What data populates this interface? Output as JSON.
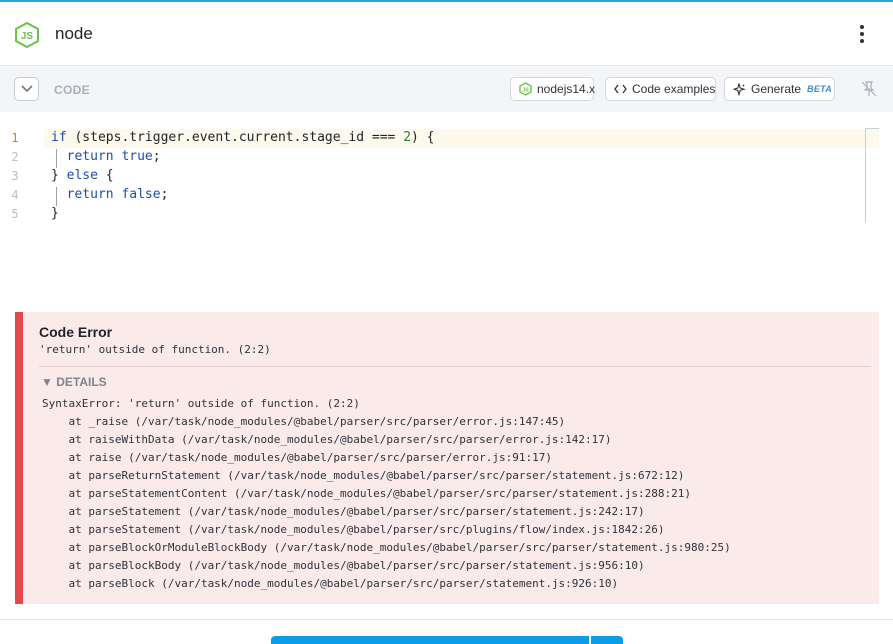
{
  "header": {
    "title": "node",
    "logo_icon": "nodejs-logo-icon",
    "menu_icon": "kebab-menu-icon"
  },
  "toolbar": {
    "code_label": "CODE",
    "runtime_label": "nodejs14.x",
    "examples_label": "Code examples",
    "generate_label": "Generate",
    "beta_label": "BETA"
  },
  "editor": {
    "line_numbers": [
      "1",
      "2",
      "3",
      "4",
      "5"
    ],
    "active_line": 1
  },
  "error": {
    "title": "Code Error",
    "message": "'return' outside of function. (2:2)",
    "details_label": "▼ DETAILS",
    "trace": [
      "SyntaxError: 'return' outside of function. (2:2)",
      "    at _raise (/var/task/node_modules/@babel/parser/src/parser/error.js:147:45)",
      "    at raiseWithData (/var/task/node_modules/@babel/parser/src/parser/error.js:142:17)",
      "    at raise (/var/task/node_modules/@babel/parser/src/parser/error.js:91:17)",
      "    at parseReturnStatement (/var/task/node_modules/@babel/parser/src/parser/statement.js:672:12)",
      "    at parseStatementContent (/var/task/node_modules/@babel/parser/src/parser/statement.js:288:21)",
      "    at parseStatement (/var/task/node_modules/@babel/parser/src/parser/statement.js:242:17)",
      "    at parseStatement (/var/task/node_modules/@babel/parser/src/plugins/flow/index.js:1842:26)",
      "    at parseBlockOrModuleBlockBody (/var/task/node_modules/@babel/parser/src/parser/statement.js:980:25)",
      "    at parseBlockBody (/var/task/node_modules/@babel/parser/src/parser/statement.js:956:10)",
      "    at parseBlock (/var/task/node_modules/@babel/parser/src/parser/statement.js:926:10)"
    ]
  },
  "colors": {
    "accent": "#0c9be8",
    "error_border": "#e5484d",
    "error_bg": "#fbeaea",
    "node_green": "#6cc24a"
  }
}
